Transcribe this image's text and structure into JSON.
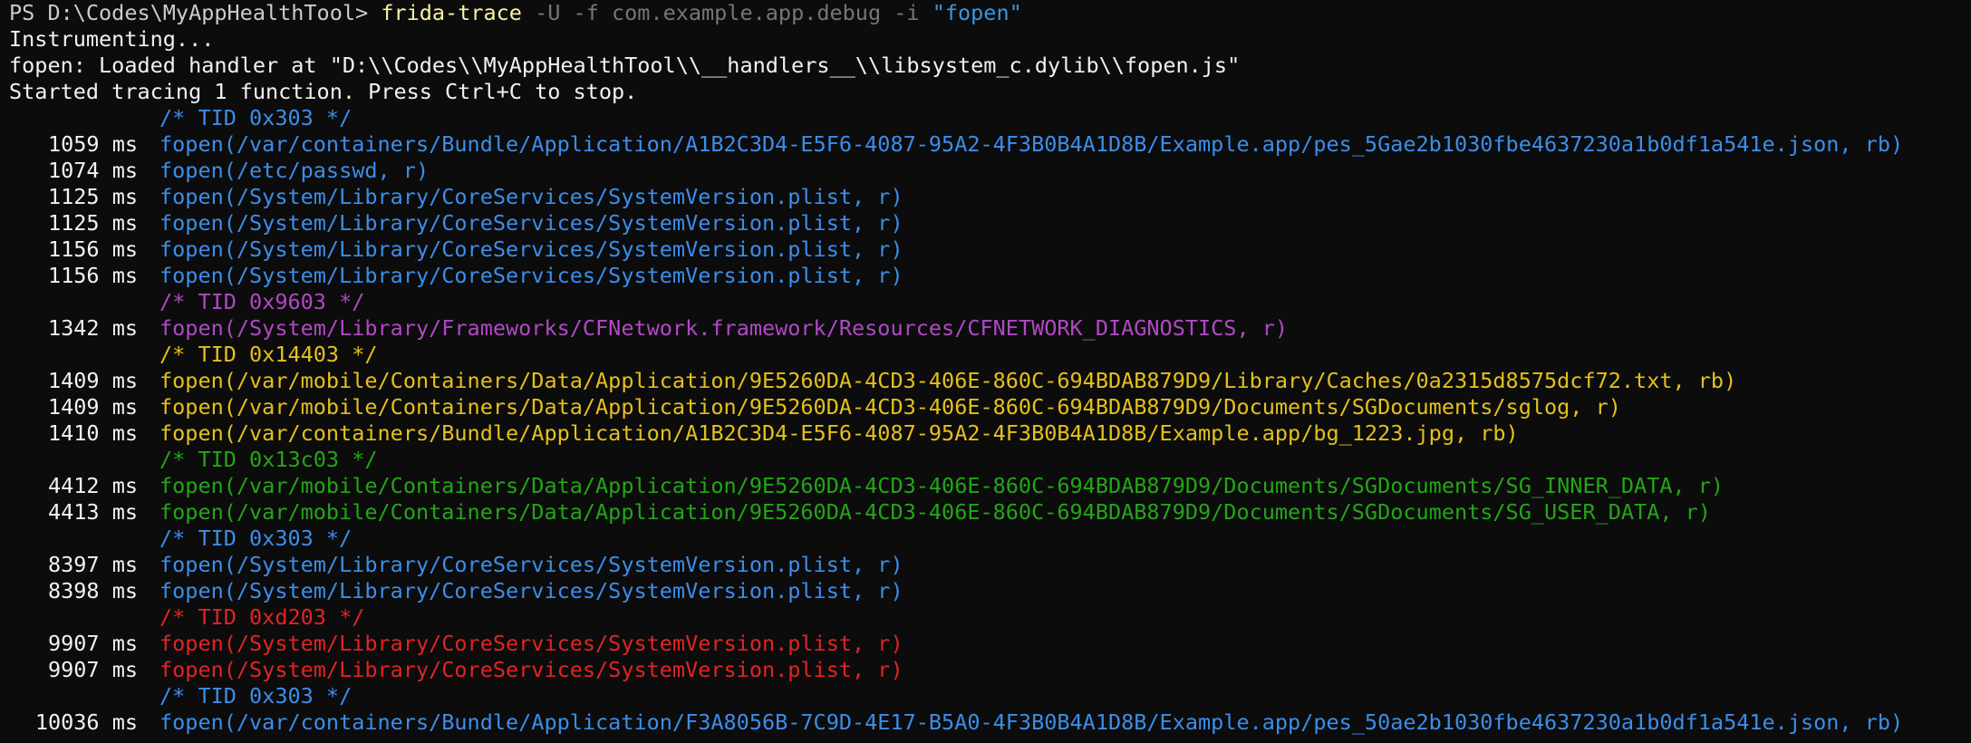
{
  "terminal": {
    "prompt": "PS D:\\Codes\\MyAppHealthTool> ",
    "command": "frida-trace",
    "args": " -U -f com.example.app.debug -i ",
    "arg_string": "\"fopen\"",
    "line_instrumenting": "Instrumenting...",
    "line_handler": "fopen: Loaded handler at \"D:\\\\Codes\\\\MyAppHealthTool\\\\__handlers__\\\\libsystem_c.dylib\\\\fopen.js\"",
    "line_started": "Started tracing 1 function. Press Ctrl+C to stop.",
    "entries": [
      {
        "kind": "tid",
        "text": "/* TID 0x303 */",
        "color": "blue"
      },
      {
        "kind": "call",
        "time": "1059 ms",
        "text": "fopen(/var/containers/Bundle/Application/A1B2C3D4-E5F6-4087-95A2-4F3B0B4A1D8B/Example.app/pes_5Gae2b1030fbe4637230a1b0df1a541e.json, rb)",
        "color": "blue"
      },
      {
        "kind": "call",
        "time": "1074 ms",
        "text": "fopen(/etc/passwd, r)",
        "color": "blue"
      },
      {
        "kind": "call",
        "time": "1125 ms",
        "text": "fopen(/System/Library/CoreServices/SystemVersion.plist, r)",
        "color": "blue"
      },
      {
        "kind": "call",
        "time": "1125 ms",
        "text": "fopen(/System/Library/CoreServices/SystemVersion.plist, r)",
        "color": "blue"
      },
      {
        "kind": "call",
        "time": "1156 ms",
        "text": "fopen(/System/Library/CoreServices/SystemVersion.plist, r)",
        "color": "blue"
      },
      {
        "kind": "call",
        "time": "1156 ms",
        "text": "fopen(/System/Library/CoreServices/SystemVersion.plist, r)",
        "color": "blue"
      },
      {
        "kind": "tid",
        "text": "/* TID 0x9603 */",
        "color": "purple"
      },
      {
        "kind": "call",
        "time": "1342 ms",
        "text": "fopen(/System/Library/Frameworks/CFNetwork.framework/Resources/CFNETWORK_DIAGNOSTICS, r)",
        "color": "purple"
      },
      {
        "kind": "tid",
        "text": "/* TID 0x14403 */",
        "color": "yellow"
      },
      {
        "kind": "call",
        "time": "1409 ms",
        "text": "fopen(/var/mobile/Containers/Data/Application/9E5260DA-4CD3-406E-860C-694BDAB879D9/Library/Caches/0a2315d8575dcf72.txt, rb)",
        "color": "yellow"
      },
      {
        "kind": "call",
        "time": "1409 ms",
        "text": "fopen(/var/mobile/Containers/Data/Application/9E5260DA-4CD3-406E-860C-694BDAB879D9/Documents/SGDocuments/sglog, r)",
        "color": "yellow"
      },
      {
        "kind": "call",
        "time": "1410 ms",
        "text": "fopen(/var/containers/Bundle/Application/A1B2C3D4-E5F6-4087-95A2-4F3B0B4A1D8B/Example.app/bg_1223.jpg, rb)",
        "color": "yellow"
      },
      {
        "kind": "tid",
        "text": "/* TID 0x13c03 */",
        "color": "green"
      },
      {
        "kind": "call",
        "time": "4412 ms",
        "text": "fopen(/var/mobile/Containers/Data/Application/9E5260DA-4CD3-406E-860C-694BDAB879D9/Documents/SGDocuments/SG_INNER_DATA, r)",
        "color": "green"
      },
      {
        "kind": "call",
        "time": "4413 ms",
        "text": "fopen(/var/mobile/Containers/Data/Application/9E5260DA-4CD3-406E-860C-694BDAB879D9/Documents/SGDocuments/SG_USER_DATA, r)",
        "color": "green"
      },
      {
        "kind": "tid",
        "text": "/* TID 0x303 */",
        "color": "blue"
      },
      {
        "kind": "call",
        "time": "8397 ms",
        "text": "fopen(/System/Library/CoreServices/SystemVersion.plist, r)",
        "color": "blue"
      },
      {
        "kind": "call",
        "time": "8398 ms",
        "text": "fopen(/System/Library/CoreServices/SystemVersion.plist, r)",
        "color": "blue"
      },
      {
        "kind": "tid",
        "text": "/* TID 0xd203 */",
        "color": "red"
      },
      {
        "kind": "call",
        "time": "9907 ms",
        "text": "fopen(/System/Library/CoreServices/SystemVersion.plist, r)",
        "color": "red"
      },
      {
        "kind": "call",
        "time": "9907 ms",
        "text": "fopen(/System/Library/CoreServices/SystemVersion.plist, r)",
        "color": "red"
      },
      {
        "kind": "tid",
        "text": "/* TID 0x303 */",
        "color": "blue"
      },
      {
        "kind": "call",
        "time": "10036 ms",
        "text": "fopen(/var/containers/Bundle/Application/F3A8056B-7C9D-4E17-B5A0-4F3B0B4A1D8B/Example.app/pes_50ae2b1030fbe4637230a1b0df1a541e.json, rb)",
        "color": "blue"
      }
    ]
  },
  "colors": {
    "background": "#0c0c0c",
    "blue": "#3b8eea",
    "purple": "#b148c6",
    "yellow": "#e5c01a",
    "green": "#23a617",
    "red": "#e12424",
    "command": "#f9f1a5"
  }
}
